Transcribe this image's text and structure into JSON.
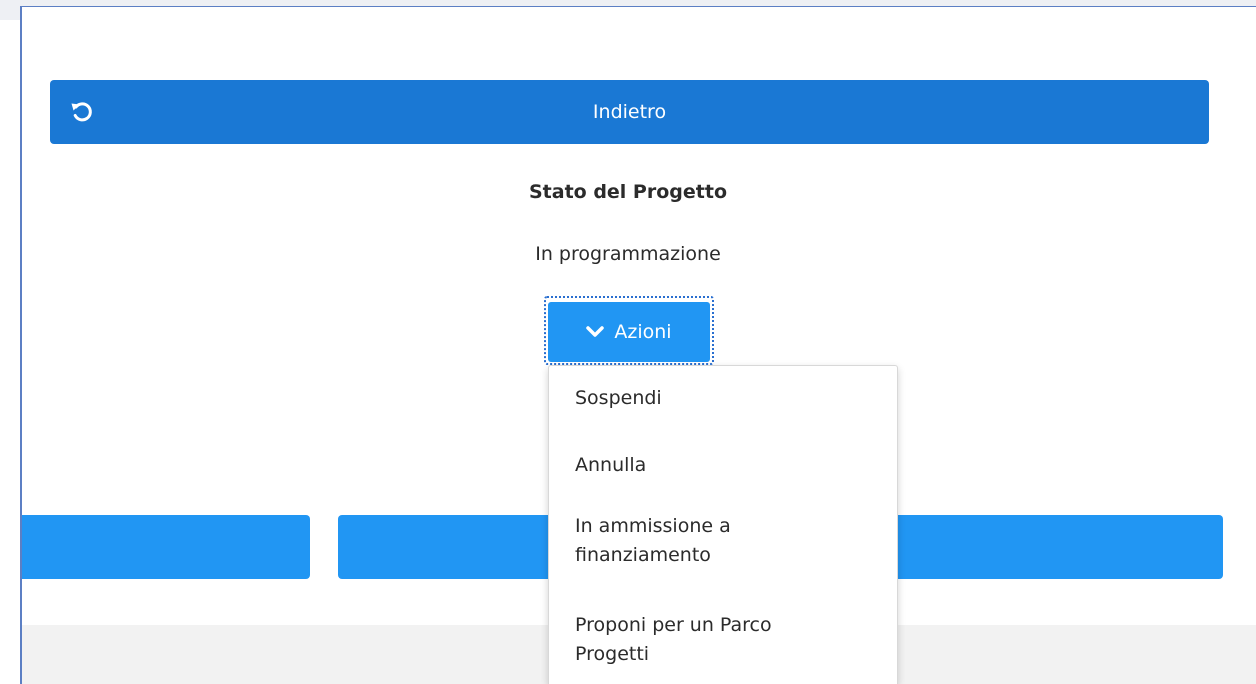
{
  "header": {
    "back_label": "Indietro",
    "back_icon": "undo-icon"
  },
  "project": {
    "title": "Stato del Progetto",
    "status": "In programmazione"
  },
  "actions": {
    "button_label": "Azioni",
    "button_icon": "chevron-down-icon",
    "menu": [
      {
        "label": "Sospendi"
      },
      {
        "label": "Annulla"
      },
      {
        "label": "In ammissione a finanziamento"
      },
      {
        "label": "Proponi per un Parco Progetti"
      }
    ]
  },
  "colors": {
    "back_button": "#1a78d4",
    "action_button": "#2196f3",
    "frame": "#5c7fc4",
    "footer": "#f2f2f2"
  }
}
